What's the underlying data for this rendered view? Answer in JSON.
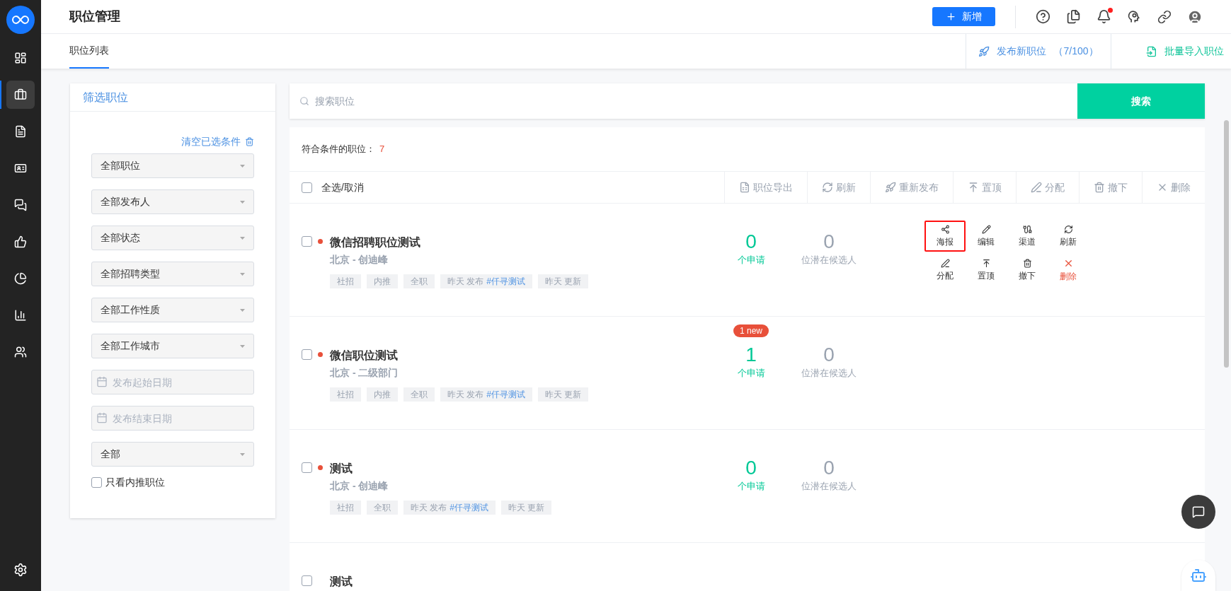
{
  "nav": [
    {
      "selected": false
    },
    {
      "selected": true
    },
    {
      "selected": false
    },
    {
      "selected": false
    },
    {
      "selected": false
    },
    {
      "selected": false
    },
    {
      "selected": false
    },
    {
      "selected": false
    },
    {
      "selected": false
    }
  ],
  "header": {
    "title": "职位管理",
    "new_button": "新增",
    "notification": true
  },
  "tabs": [
    {
      "label": "职位列表",
      "selected": true
    }
  ],
  "header_actions": [
    {
      "kind": "publish",
      "label": "发布新职位",
      "count": "（7/100）"
    },
    {
      "kind": "import",
      "label": "批量导入职位"
    }
  ],
  "filter": {
    "title": "筛选职位",
    "clear": "清空已选条件",
    "fields": [
      {
        "kind": "select",
        "value": "全部职位"
      },
      {
        "kind": "select",
        "value": "全部发布人"
      },
      {
        "kind": "select",
        "value": "全部状态"
      },
      {
        "kind": "select",
        "value": "全部招聘类型"
      },
      {
        "kind": "select",
        "value": "全部工作性质"
      },
      {
        "kind": "select",
        "value": "全部工作城市"
      },
      {
        "kind": "date",
        "placeholder": "发布起始日期"
      },
      {
        "kind": "date",
        "placeholder": "发布结束日期"
      },
      {
        "kind": "select",
        "value": "全部"
      }
    ],
    "only_referral": {
      "label": "只看内推职位",
      "checked": false
    }
  },
  "search": {
    "placeholder": "搜索职位",
    "button": "搜索"
  },
  "results": {
    "label": "符合条件的职位：",
    "count": "7"
  },
  "toolbar": {
    "select_all": {
      "label": "全选/取消",
      "checked": false
    },
    "actions": [
      {
        "kind": "export",
        "label": "职位导出",
        "disabled": true
      },
      {
        "kind": "refresh",
        "label": "刷新",
        "disabled": true
      },
      {
        "kind": "republish",
        "label": "重新发布",
        "disabled": true
      },
      {
        "kind": "top",
        "label": "置顶",
        "disabled": true
      },
      {
        "kind": "assign",
        "label": "分配",
        "disabled": true
      },
      {
        "kind": "withdraw",
        "label": "撤下",
        "disabled": true
      },
      {
        "kind": "delete",
        "label": "删除",
        "disabled": true
      }
    ]
  },
  "jobs": [
    {
      "checked": false,
      "dot": true,
      "title": "微信招聘职位测试",
      "location": "北京 - 创迪峰",
      "tags": [
        {
          "text": "社招"
        },
        {
          "text": "内推"
        },
        {
          "text": "全职"
        },
        {
          "text": "昨天 发布",
          "link": "#仟寻测试"
        },
        {
          "text": "昨天 更新"
        }
      ],
      "applications": "0",
      "applications_label": "个申请",
      "candidates": "0",
      "candidates_label": "位潜在候选人",
      "actions": [
        {
          "kind": "share",
          "label": "海报",
          "selected": true
        },
        {
          "kind": "edit",
          "label": "编辑",
          "selected": false
        },
        {
          "kind": "channel",
          "label": "渠道",
          "selected": false
        },
        {
          "kind": "refresh",
          "label": "刷新",
          "selected": false
        },
        {
          "kind": "assign",
          "label": "分配",
          "selected": false
        },
        {
          "kind": "top",
          "label": "置顶",
          "selected": false
        },
        {
          "kind": "withdraw",
          "label": "撤下",
          "selected": false
        },
        {
          "kind": "delete",
          "label": "删除",
          "selected": false
        }
      ]
    },
    {
      "checked": false,
      "dot": true,
      "title": "微信职位测试",
      "location": "北京 - 二级部门",
      "tags": [
        {
          "text": "社招"
        },
        {
          "text": "内推"
        },
        {
          "text": "全职"
        },
        {
          "text": "昨天 发布",
          "link": "#仟寻测试"
        },
        {
          "text": "昨天 更新"
        }
      ],
      "applications": "1",
      "applications_label": "个申请",
      "badge": "1 new",
      "candidates": "0",
      "candidates_label": "位潜在候选人"
    },
    {
      "checked": false,
      "dot": true,
      "title": "测试",
      "location": "北京 - 创迪峰",
      "tags": [
        {
          "text": "社招"
        },
        {
          "text": "全职"
        },
        {
          "text": "昨天 发布",
          "link": "#仟寻测试"
        },
        {
          "text": "昨天 更新"
        }
      ],
      "applications": "0",
      "applications_label": "个申请",
      "candidates": "0",
      "candidates_label": "位潜在候选人"
    },
    {
      "checked": false,
      "dot": false,
      "title": "测试"
    }
  ]
}
